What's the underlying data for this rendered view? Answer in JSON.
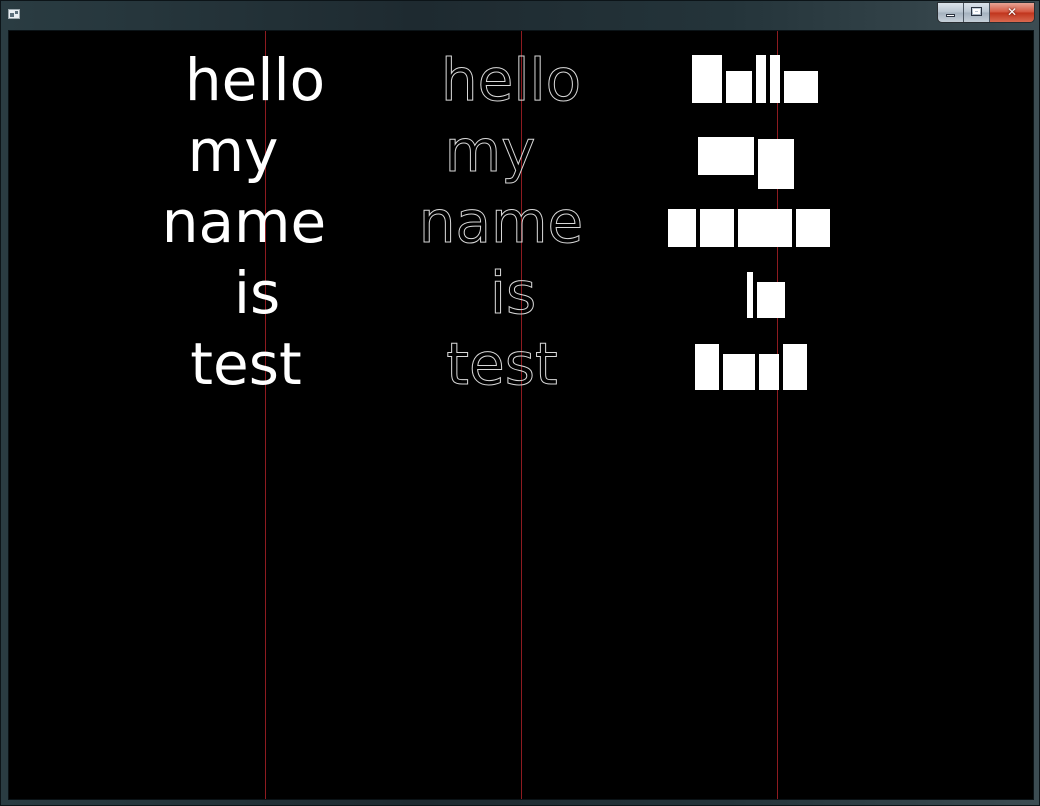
{
  "window": {
    "title": "",
    "buttons": {
      "minimize": "minimize",
      "maximize": "maximize",
      "close": "✕"
    }
  },
  "canvas": {
    "background": "#000000",
    "guide_color": "#8e1b20",
    "words": [
      "hello",
      "my",
      "name",
      "is",
      "test"
    ],
    "columns": [
      {
        "style": "filled",
        "color": "#ffffff"
      },
      {
        "style": "outline",
        "color": "#d8d8d8"
      },
      {
        "style": "box-glyphs",
        "color": "#ffffff"
      }
    ]
  }
}
